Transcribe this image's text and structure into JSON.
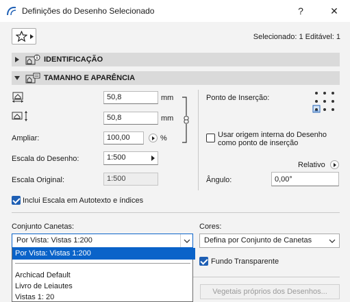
{
  "window": {
    "title": "Definições do Desenho Selecionado",
    "help_label": "?",
    "close_label": "✕"
  },
  "header": {
    "selected_info": "Selecionado: 1 Editável: 1"
  },
  "sections": {
    "identification": "IDENTIFICAÇÃO",
    "size": "TAMANHO E APARÊNCIA"
  },
  "size": {
    "width_value": "50,8",
    "width_unit": "mm",
    "height_value": "50,8",
    "height_unit": "mm",
    "scale_label": "Ampliar:",
    "scale_value": "100,00",
    "scale_unit": "%",
    "drawing_scale_label": "Escala do Desenho:",
    "drawing_scale_value": "1:500",
    "original_scale_label": "Escala Original:",
    "original_scale_value": "1:500",
    "autotext_label": "Inclui Escala em Autotexto e índices",
    "autotext_checked": true
  },
  "insertion": {
    "label": "Ponto de Inserção:",
    "use_origin_label_1": "Usar origem interna do Desenho",
    "use_origin_label_2": "como ponto de inserção",
    "use_origin_checked": false,
    "relative_label": "Relativo",
    "angle_label": "Ângulo:",
    "angle_value": "0,00°"
  },
  "pens": {
    "label": "Conjunto Canetas:",
    "selected": "Por Vista: Vistas 1:200",
    "options": [
      "Por Vista: Vistas 1:200",
      "Archicad Default",
      "Livro de Leiautes",
      "Vistas 1: 20"
    ]
  },
  "colors": {
    "label": "Cores:",
    "selected": "Defina por Conjunto de Canetas",
    "transparent_label": "Fundo Transparente",
    "transparent_checked": true,
    "vegetation_button": "Vegetais próprios dos Desenhos..."
  }
}
